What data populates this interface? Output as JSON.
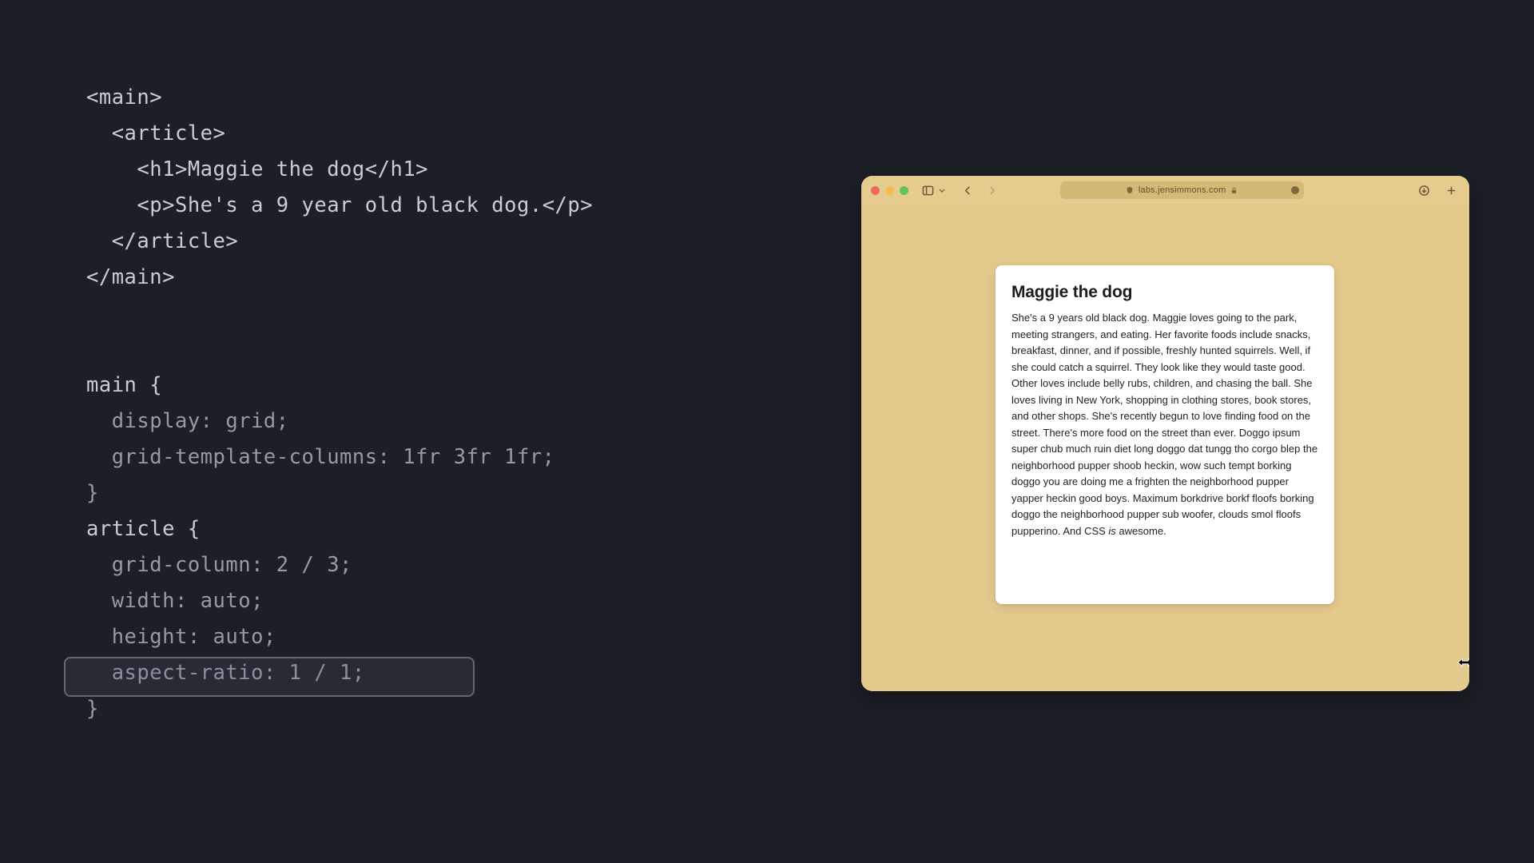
{
  "code": {
    "html": {
      "l1": "<main>",
      "l2": "  <article>",
      "l3a": "    <h1>",
      "l3b": "Maggie the dog",
      "l3c": "</h1>",
      "l4a": "    <p>",
      "l4b": "She's a 9 year old black dog.",
      "l4c": "</p>",
      "l5": "  </article>",
      "l6": "</main>"
    },
    "css": {
      "l1": "main {",
      "l2": "  display: grid;",
      "l3": "  grid-template-columns: 1fr 3fr 1fr;",
      "l4": "}",
      "l5": "article {",
      "l6": "  grid-column: 2 / 3;",
      "l7": "  width: auto;",
      "l8": "  height: auto;",
      "l9": "  aspect-ratio: 1 / 1;",
      "l10": "}"
    }
  },
  "browser": {
    "url": "labs.jensimmons.com"
  },
  "article": {
    "title": "Maggie the dog",
    "body_pre": "She's a 9 years old black dog. Maggie loves going to the park, meeting strangers, and eating. Her favorite foods include snacks, breakfast, dinner, and if possible, freshly hunted squirrels. Well, if she could catch a squirrel. They look like they would taste good. Other loves include belly rubs, children, and chasing the ball. She loves living in New York, shopping in clothing stores, book stores, and other shops. She's recently begun to love finding food on the street. There's more food on the street than ever. Doggo ipsum super chub much ruin diet long doggo dat tungg tho corgo blep the neighborhood pupper shoob heckin, wow such tempt borking doggo you are doing me a frighten the neighborhood pupper yapper heckin good boys. Maximum borkdrive borkf floofs borking doggo the neighborhood pupper sub woofer, clouds smol floofs pupperino. And CSS ",
    "body_italic": "is",
    "body_post": " awesome."
  }
}
